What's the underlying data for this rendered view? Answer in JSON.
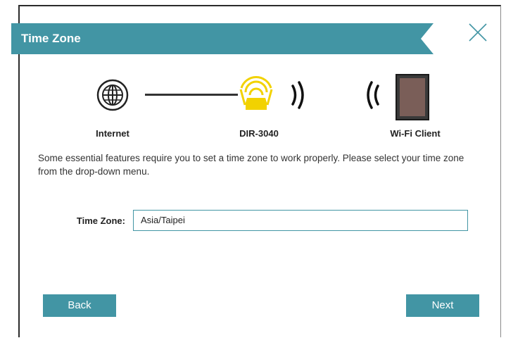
{
  "dialog": {
    "title": "Time Zone",
    "close_icon": "close-x-icon"
  },
  "topology": {
    "internet_label": "Internet",
    "router_label": "DIR-3040",
    "client_label": "Wi-Fi Client",
    "internet_icon": "globe-icon",
    "router_icon": "router-icon",
    "client_icon": "tablet-icon"
  },
  "description": "Some essential features require you to set a time zone to work properly. Please select your time zone from the drop-down menu.",
  "timezone": {
    "label": "Time Zone:",
    "value": "Asia/Taipei"
  },
  "buttons": {
    "back": "Back",
    "next": "Next"
  },
  "colors": {
    "accent": "#4295a4",
    "router_yellow": "#f2d200"
  }
}
